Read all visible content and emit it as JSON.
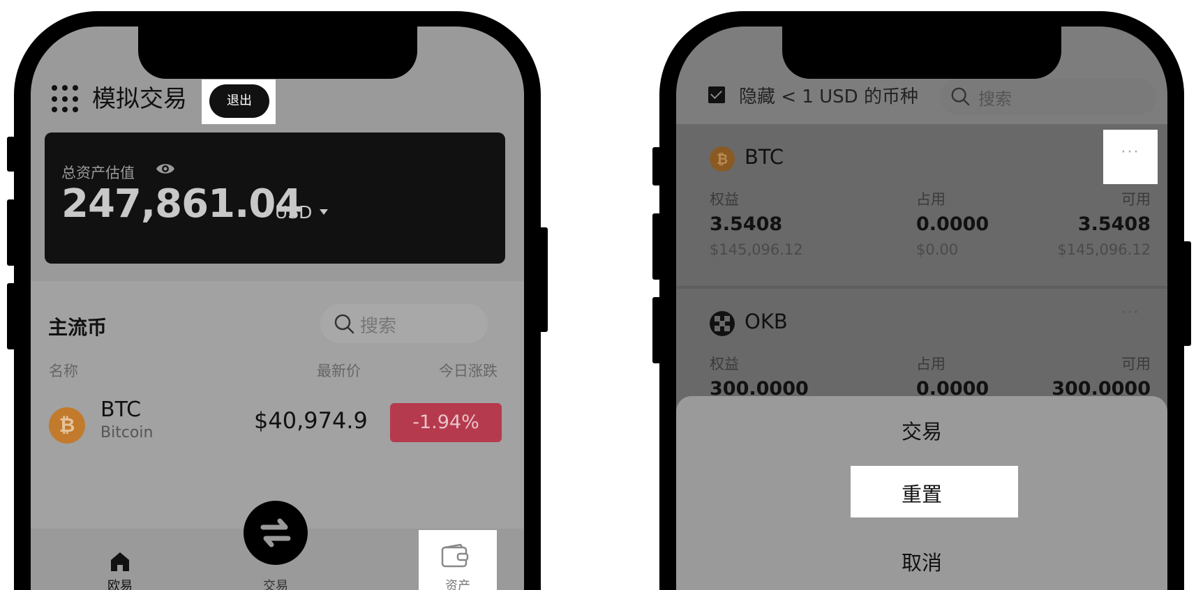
{
  "left_phone": {
    "header": {
      "title": "模拟交易",
      "exit_label": "退出"
    },
    "balance": {
      "label": "总资产估值",
      "value": "247,861.04",
      "unit": "USD"
    },
    "market": {
      "title": "主流币",
      "search_placeholder": "搜索",
      "columns": {
        "name": "名称",
        "price": "最新价",
        "change": "今日涨跌"
      },
      "rows": [
        {
          "symbol": "BTC",
          "name": "Bitcoin",
          "price": "$40,974.9",
          "change": "-1.94%",
          "coin_glyph": "₿"
        }
      ]
    },
    "tabbar": {
      "home": "欧易",
      "trade": "交易",
      "assets": "资产"
    }
  },
  "right_phone": {
    "filter": {
      "hide_label": "隐藏 < 1 USD 的币种",
      "search_placeholder": "搜索"
    },
    "coins": [
      {
        "symbol": "BTC",
        "coin_glyph": "₿",
        "equity_label": "权益",
        "used_label": "占用",
        "available_label": "可用",
        "equity": "3.5408",
        "used": "0.0000",
        "available": "3.5408",
        "equity_usd": "$145,096.12",
        "used_usd": "$0.00",
        "available_usd": "$145,096.12"
      },
      {
        "symbol": "OKB",
        "equity_label": "权益",
        "used_label": "占用",
        "available_label": "可用",
        "equity": "300.0000",
        "used": "0.0000",
        "available": "300.0000"
      }
    ],
    "more_label": "···",
    "sheet": {
      "trade": "交易",
      "reset": "重置",
      "cancel": "取消"
    }
  },
  "colors": {
    "negative": "#b63a4e",
    "btc": "#c27a2c",
    "dark": "#111111",
    "overlay": "#9a9a9a"
  }
}
